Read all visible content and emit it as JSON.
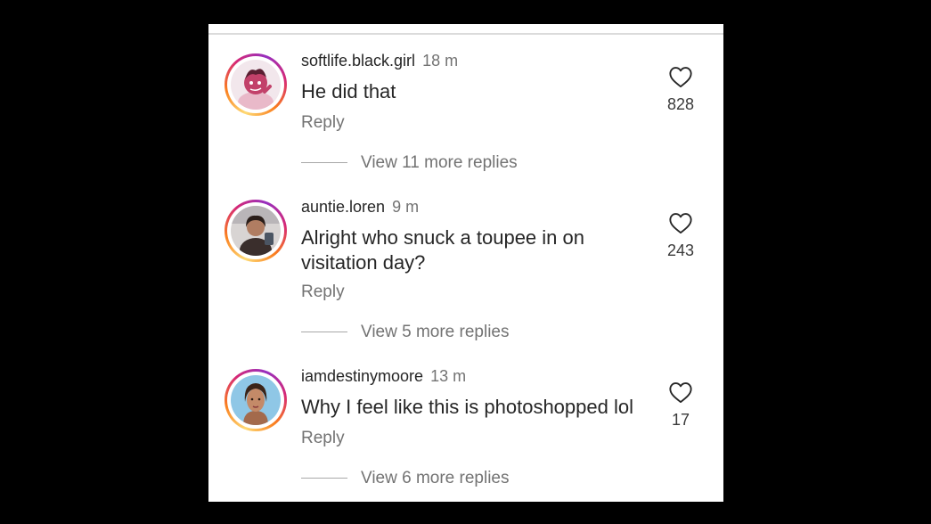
{
  "comments": [
    {
      "username": "softlife.black.girl",
      "time": "18 m",
      "text": "He did that",
      "reply_label": "Reply",
      "likes": "828",
      "view_replies": "View 11 more replies",
      "avatar_colors": {
        "bg": "#f2e7ec",
        "fg": "#c2416a"
      }
    },
    {
      "username": "auntie.loren",
      "time": "9 m",
      "text": "Alright who snuck a toupee in on visitation day?",
      "reply_label": "Reply",
      "likes": "243",
      "view_replies": "View 5 more replies",
      "avatar_colors": {
        "bg": "#d8d4d3",
        "fg": "#3a2e2c"
      }
    },
    {
      "username": "iamdestinymoore",
      "time": "13 m",
      "text": "Why I feel like this is photoshopped lol",
      "reply_label": "Reply",
      "likes": "17",
      "view_replies": "View 6 more replies",
      "avatar_colors": {
        "bg": "#8fc7e6",
        "fg": "#a36a4c"
      }
    }
  ],
  "colors": {
    "text_primary": "#262626",
    "text_secondary": "#737373",
    "story_ring": [
      "#feda75",
      "#fa7e1e",
      "#d62976",
      "#962fbf"
    ]
  }
}
